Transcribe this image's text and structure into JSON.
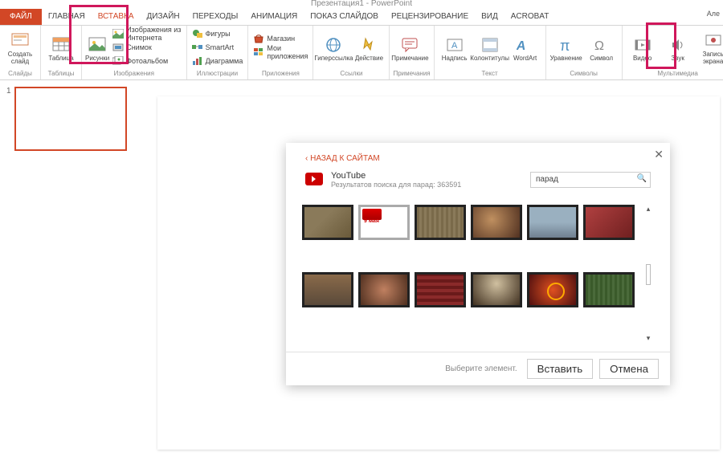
{
  "app": {
    "title": "Презентация1 - PowerPoint"
  },
  "account": "Але",
  "menu": {
    "file": "ФАЙЛ",
    "items": [
      "ГЛАВНАЯ",
      "ВСТАВКА",
      "ДИЗАЙН",
      "ПЕРЕХОДЫ",
      "АНИМАЦИЯ",
      "ПОКАЗ СЛАЙДОВ",
      "РЕЦЕНЗИРОВАНИЕ",
      "ВИД",
      "ACROBAT"
    ],
    "active_index": 1
  },
  "ribbon": {
    "g0": {
      "label": "Слайды",
      "new_slide": "Создать\nслайд"
    },
    "g1": {
      "label": "Таблицы",
      "table": "Таблица"
    },
    "g2": {
      "label": "Изображения",
      "pictures": "Рисунки",
      "online": "Изображения из Интернета",
      "screenshot": "Снимок",
      "album": "Фотоальбом"
    },
    "g3": {
      "label": "Иллюстрации",
      "shapes": "Фигуры",
      "smartart": "SmartArt",
      "chart": "Диаграмма"
    },
    "g4": {
      "label": "Приложения",
      "store": "Магазин",
      "myapps": "Мои приложения"
    },
    "g5": {
      "label": "Ссылки",
      "hyperlink": "Гиперссылка",
      "action": "Действие"
    },
    "g6": {
      "label": "Примечания",
      "comment": "Примечание"
    },
    "g7": {
      "label": "Текст",
      "textbox": "Надпись",
      "header": "Колонтитулы",
      "wordart": "WordArt"
    },
    "g8": {
      "label": "Символы",
      "equation": "Уравнение",
      "symbol": "Символ"
    },
    "g9": {
      "label": "Мультимедиа",
      "video": "Видео",
      "audio": "Звук",
      "screen": "Запись\nэкрана"
    }
  },
  "thumbs": {
    "n1": "1"
  },
  "dialog": {
    "back": "‹ НАЗАД К САЙТАМ",
    "source": "YouTube",
    "results_text": "Результатов поиска для парад: 363591",
    "search_value": "парад",
    "footer_hint": "Выберите элемент.",
    "insert": "Вставить",
    "cancel": "Отмена"
  }
}
